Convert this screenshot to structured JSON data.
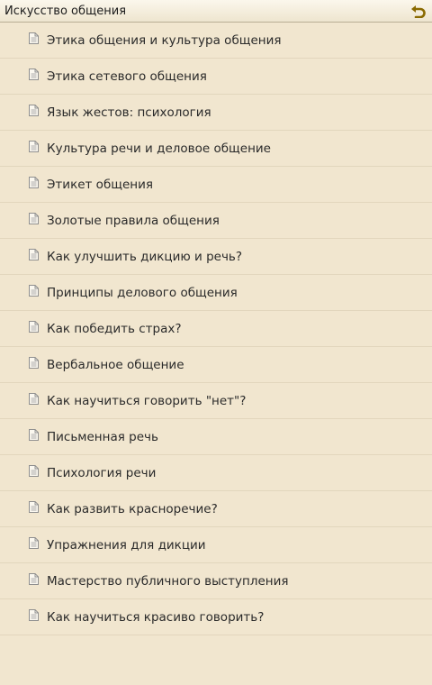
{
  "header": {
    "title": "Искусство общения",
    "back_icon": "undo-arrow-icon"
  },
  "items": [
    {
      "label": "Этика общения и культура общения",
      "icon": "document-icon"
    },
    {
      "label": "Этика сетевого общения",
      "icon": "document-icon"
    },
    {
      "label": "Язык жестов: психология",
      "icon": "document-icon"
    },
    {
      "label": "Культура речи и деловое общение",
      "icon": "document-icon"
    },
    {
      "label": "Этикет общения",
      "icon": "document-icon"
    },
    {
      "label": "Золотые правила общения",
      "icon": "document-icon"
    },
    {
      "label": "Как улучшить дикцию и речь?",
      "icon": "document-icon"
    },
    {
      "label": "Принципы делового общения",
      "icon": "document-icon"
    },
    {
      "label": "Как победить страх?",
      "icon": "document-icon"
    },
    {
      "label": "Вербальное общение",
      "icon": "document-icon"
    },
    {
      "label": "Как научиться говорить \"нет\"?",
      "icon": "document-icon"
    },
    {
      "label": "Письменная речь",
      "icon": "document-icon"
    },
    {
      "label": "Психология речи",
      "icon": "document-icon"
    },
    {
      "label": "Как развить красноречие?",
      "icon": "document-icon"
    },
    {
      "label": "Упражнения для дикции",
      "icon": "document-icon"
    },
    {
      "label": "Мастерство публичного выступления",
      "icon": "document-icon"
    },
    {
      "label": "Как научиться красиво говорить?",
      "icon": "document-icon"
    }
  ],
  "colors": {
    "background": "#f1e6cf",
    "divider": "#e2d6bd",
    "accent_back": "#8a6a00"
  }
}
